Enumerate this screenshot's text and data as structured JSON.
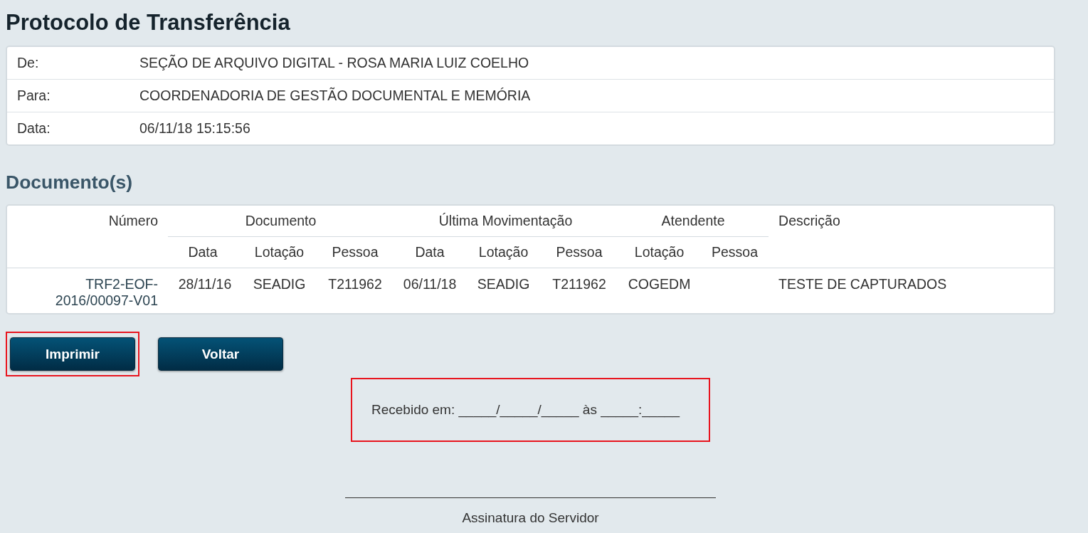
{
  "title": "Protocolo de Transferência",
  "header": [
    {
      "label": "De:",
      "value": "SEÇÃO DE ARQUIVO DIGITAL - ROSA MARIA LUIZ COELHO"
    },
    {
      "label": "Para:",
      "value": "COORDENADORIA DE GESTÃO DOCUMENTAL E MEMÓRIA"
    },
    {
      "label": "Data:",
      "value": "06/11/18 15:15:56"
    }
  ],
  "section_title": "Documento(s)",
  "table": {
    "groups": [
      {
        "label": "Número"
      },
      {
        "label": "Documento",
        "columns": [
          "Data",
          "Lotação",
          "Pessoa"
        ]
      },
      {
        "label": "Última Movimentação",
        "columns": [
          "Data",
          "Lotação",
          "Pessoa"
        ]
      },
      {
        "label": "Atendente",
        "columns": [
          "Lotação",
          "Pessoa"
        ]
      },
      {
        "label": "Descrição"
      }
    ],
    "rows": [
      [
        "TRF2-EOF-2016/00097-V01",
        "28/11/16",
        "SEADIG",
        "T211962",
        "06/11/18",
        "SEADIG",
        "T211962",
        "COGEDM",
        "",
        "TESTE DE CAPTURADOS"
      ]
    ]
  },
  "buttons": [
    {
      "label": "Imprimir",
      "highlighted": true
    },
    {
      "label": "Voltar",
      "highlighted": false
    }
  ],
  "receipt": {
    "text": "Recebido em: _____/_____/_____ às _____:_____",
    "highlighted": true
  },
  "signature": {
    "label": "Assinatura do Servidor"
  }
}
